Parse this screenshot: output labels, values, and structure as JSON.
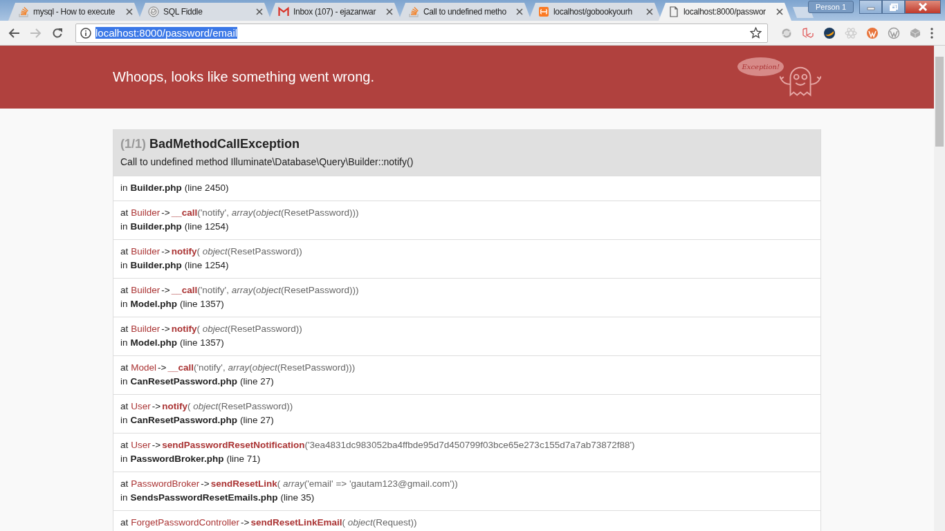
{
  "browser": {
    "tabs": [
      {
        "title": "mysql - How to execute",
        "kind": "stack",
        "selected": false
      },
      {
        "title": "SQL Fiddle",
        "kind": "shell",
        "selected": false
      },
      {
        "title": "Inbox (107) - ejazanwar",
        "kind": "mail",
        "selected": false
      },
      {
        "title": "Call to undefined metho",
        "kind": "stack",
        "selected": false
      },
      {
        "title": "localhost/gobookyourh",
        "kind": "xampp",
        "selected": false
      },
      {
        "title": "localhost:8000/passwor",
        "kind": "page",
        "selected": true
      }
    ],
    "profile": "Person 1",
    "address": {
      "value": "localhost:8000/password/email",
      "selected": true
    }
  },
  "page": {
    "header": "Whoops, looks like something went wrong.",
    "mascot_text": "Exception!",
    "exception": {
      "count": "(1/1)",
      "name": "BadMethodCallException",
      "message": "Call to undefined method Illuminate\\Database\\Query\\Builder::notify()"
    },
    "frames": [
      {
        "in": "in",
        "file": "Builder.php",
        "line": "(line 2450)"
      },
      {
        "at": "at",
        "class": "Builder",
        "arrow": "->",
        "method": "__call",
        "args": "('notify', *array*(*object*(ResetPassword)))",
        "in": "in",
        "file": "Builder.php",
        "line": "(line 1254)"
      },
      {
        "at": "at",
        "class": "Builder",
        "arrow": "->",
        "method": "notify",
        "args": "( *object*(ResetPassword))",
        "in": "in",
        "file": "Builder.php",
        "line": "(line 1254)"
      },
      {
        "at": "at",
        "class": "Builder",
        "arrow": "->",
        "method": "__call",
        "args": "('notify', *array*(*object*(ResetPassword)))",
        "in": "in",
        "file": "Model.php",
        "line": "(line 1357)"
      },
      {
        "at": "at",
        "class": "Builder",
        "arrow": "->",
        "method": "notify",
        "args": "( *object*(ResetPassword))",
        "in": "in",
        "file": "Model.php",
        "line": "(line 1357)"
      },
      {
        "at": "at",
        "class": "Model",
        "arrow": "->",
        "method": "__call",
        "args": "('notify', *array*(*object*(ResetPassword)))",
        "in": "in",
        "file": "CanResetPassword.php",
        "line": "(line 27)"
      },
      {
        "at": "at",
        "class": "User",
        "arrow": "->",
        "method": "notify",
        "args": "( *object*(ResetPassword))",
        "in": "in",
        "file": "CanResetPassword.php",
        "line": "(line 27)"
      },
      {
        "at": "at",
        "class": "User",
        "arrow": "->",
        "method": "sendPasswordResetNotification",
        "args": "('3ea4831dc983052ba4ffbde95d7d450799f03bce65e273c155d7a7ab73872f88')",
        "in": "in",
        "file": "PasswordBroker.php",
        "line": "(line 71)"
      },
      {
        "at": "at",
        "class": "PasswordBroker",
        "arrow": "->",
        "method": "sendResetLink",
        "args": "( *array*('email' => 'gautam123@gmail.com'))",
        "in": "in",
        "file": "SendsPasswordResetEmails.php",
        "line": "(line 35)"
      },
      {
        "at": "at",
        "class": "ForgetPasswordController",
        "arrow": "->",
        "method": "sendResetLinkEmail",
        "args": "( *object*(Request))"
      }
    ]
  }
}
